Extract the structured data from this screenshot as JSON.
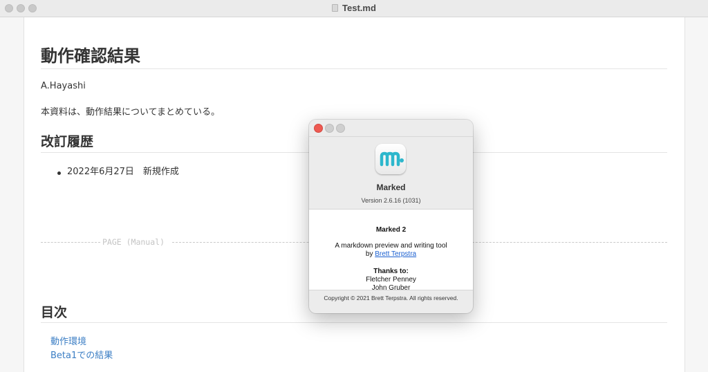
{
  "window": {
    "title": "Test.md"
  },
  "document": {
    "title": "動作確認結果",
    "author": "A.Hayashi",
    "intro": "本資料は、動作結果についてまとめている。",
    "revision_heading": "改訂履歴",
    "revision_items": [
      {
        "text": "2022年6月27日　新規作成"
      }
    ],
    "page_break_label": "PAGE (Manual)",
    "toc_heading": "目次",
    "toc_links": [
      {
        "label": "動作環境"
      },
      {
        "label": "Beta1での結果"
      }
    ]
  },
  "about_dialog": {
    "app_name": "Marked",
    "version": "Version 2.6.16 (1031)",
    "credits": {
      "product": "Marked 2",
      "tagline": "A markdown preview and writing tool",
      "by_prefix": "by",
      "author_link": "Brett Terpstra",
      "thanks_heading": "Thanks to:",
      "thanks_names": [
        "Fletcher Penney",
        "John Gruber"
      ]
    },
    "copyright": "Copyright © 2021 Brett Terpstra. All rights reserved."
  },
  "colors": {
    "link": "#3b7ec4",
    "close": "#ee5a52",
    "app_icon_teal": "#2db7cc"
  }
}
